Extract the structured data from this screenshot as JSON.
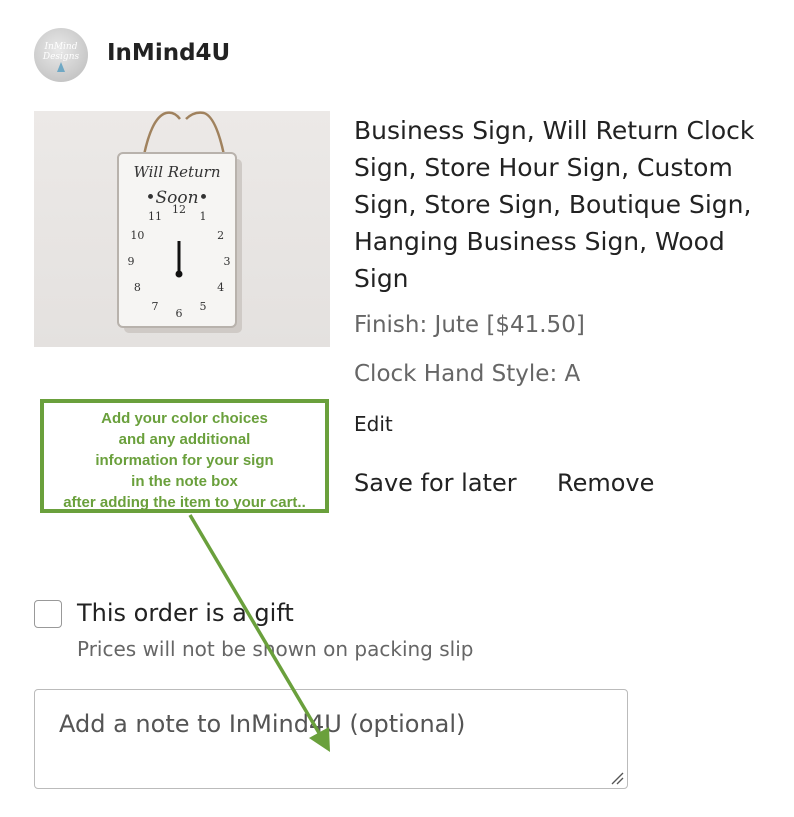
{
  "shop": {
    "name": "InMind4U",
    "avatar_text": "InMind Designs"
  },
  "product": {
    "title_lines": [
      "Business Sign, Will Return Clock",
      "Sign, Store Hour Sign, Custom",
      "Sign, Store Sign, Boutique Sign,",
      "Hanging Business Sign, Wood",
      "Sign"
    ],
    "image": {
      "sign_line1": "Will Return",
      "sign_line2": "•Soon•",
      "clock_numbers": [
        "12",
        "1",
        "2",
        "3",
        "4",
        "5",
        "6",
        "7",
        "8",
        "9",
        "10",
        "11"
      ]
    },
    "finish": "Finish: Jute [$41.50]",
    "clock_hand_style": "Clock Hand Style: A",
    "edit_label": "Edit",
    "save_for_later_label": "Save for later",
    "remove_label": "Remove"
  },
  "callout": {
    "lines": [
      "Add your color choices",
      "and any additional",
      "information for your sign",
      "in the note box",
      "after adding the item to your cart.."
    ],
    "color": "#6aa03c"
  },
  "gift": {
    "label": "This order is a gift",
    "help": "Prices will not be shown on packing slip",
    "checked": false
  },
  "note": {
    "placeholder": "Add a note to InMind4U (optional)"
  }
}
